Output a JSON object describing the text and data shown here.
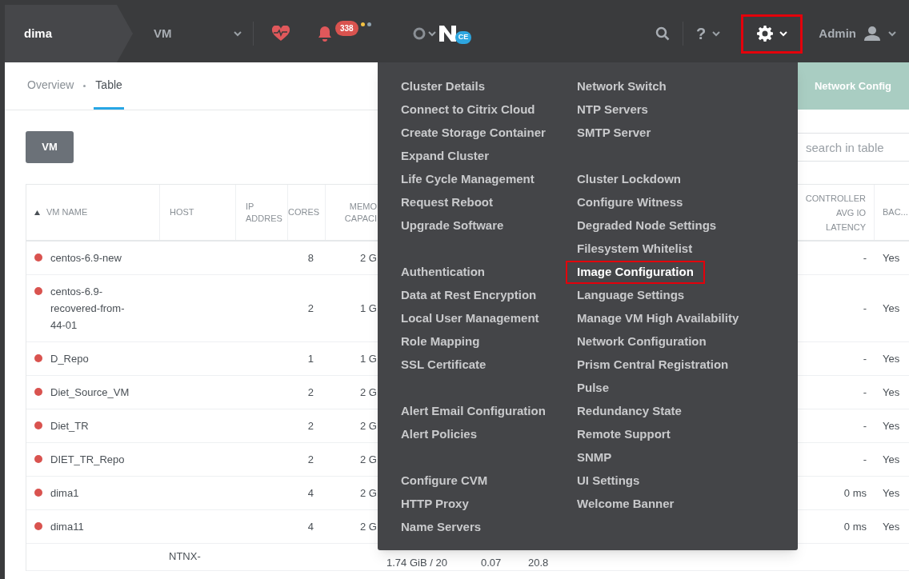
{
  "top_bar": {
    "cluster": "dima",
    "section": "VM",
    "alerts_count": "338",
    "logo_badge": "CE",
    "help": "?",
    "user": "Admin",
    "settings_highlighted": true
  },
  "tabs": [
    {
      "label": "Overview",
      "selected": false
    },
    {
      "label": "Table",
      "selected": true
    }
  ],
  "add_button": "VM",
  "network_config_button": "Network Config",
  "search": {
    "placeholder": "search in table"
  },
  "table": {
    "columns": [
      "VM NAME",
      "HOST",
      "IP ADDRES",
      "CORES",
      "MEMO CAPACI",
      "CONTROLLER AVG IO LATENCY",
      "BAC..."
    ],
    "rows": [
      {
        "color": "#d9534f",
        "name": "centos-6.9-new",
        "cores": "8",
        "memory": "2 G",
        "latency": "-",
        "backup": "Yes"
      },
      {
        "color": "#d9534f",
        "name": "centos-6.9-recovered-from-44-01",
        "cores": "2",
        "memory": "1 G",
        "latency": "-",
        "backup": "Yes"
      },
      {
        "color": "#d9534f",
        "name": "D_Repo",
        "cores": "1",
        "memory": "1 G",
        "latency": "-",
        "backup": "Yes"
      },
      {
        "color": "#d9534f",
        "name": "Diet_Source_VM",
        "cores": "2",
        "memory": "2 G",
        "latency": "-",
        "backup": "Yes"
      },
      {
        "color": "#d9534f",
        "name": "Diet_TR",
        "cores": "2",
        "memory": "2 G",
        "latency": "-",
        "backup": "Yes"
      },
      {
        "color": "#d9534f",
        "name": "DIET_TR_Repo",
        "cores": "2",
        "memory": "2 G",
        "latency": "-",
        "backup": "Yes"
      },
      {
        "color": "#d9534f",
        "name": "dima1",
        "cores": "4",
        "memory": "2 G",
        "latency": "0 ms",
        "backup": "Yes"
      },
      {
        "color": "#d9534f",
        "name": "dima11",
        "cores": "4",
        "memory": "2 G",
        "latency": "0 ms",
        "backup": "Yes"
      },
      {
        "host": "NTNX-",
        "column_6": "1.74 GiB / 20",
        "column_7": "0.07",
        "column_8": "20.8"
      }
    ]
  },
  "settings_menu": {
    "columns": [
      [
        [
          "Cluster Details",
          "Connect to Citrix Cloud",
          "Create Storage Container",
          "Expand Cluster",
          "Life Cycle Management",
          "Request Reboot",
          "Upgrade Software"
        ],
        [
          "Authentication",
          "Data at Rest Encryption",
          "Local User Management",
          "Role Mapping",
          "SSL Certificate"
        ],
        [
          "Alert Email Configuration",
          "Alert Policies"
        ],
        [
          "Configure CVM",
          "HTTP Proxy",
          "Name Servers"
        ]
      ],
      [
        [
          "Network Switch",
          "NTP Servers",
          "SMTP Server"
        ],
        [
          "Cluster Lockdown",
          "Configure Witness",
          "Degraded Node Settings",
          "Filesystem Whitelist",
          {
            "label": "Image Configuration",
            "highlighted": true
          },
          "Language Settings",
          "Manage VM High Availability",
          "Network Configuration",
          "Prism Central Registration",
          "Pulse",
          "Redundancy State",
          "Remote Support",
          "SNMP",
          "UI Settings",
          "Welcome Banner"
        ]
      ]
    ]
  }
}
